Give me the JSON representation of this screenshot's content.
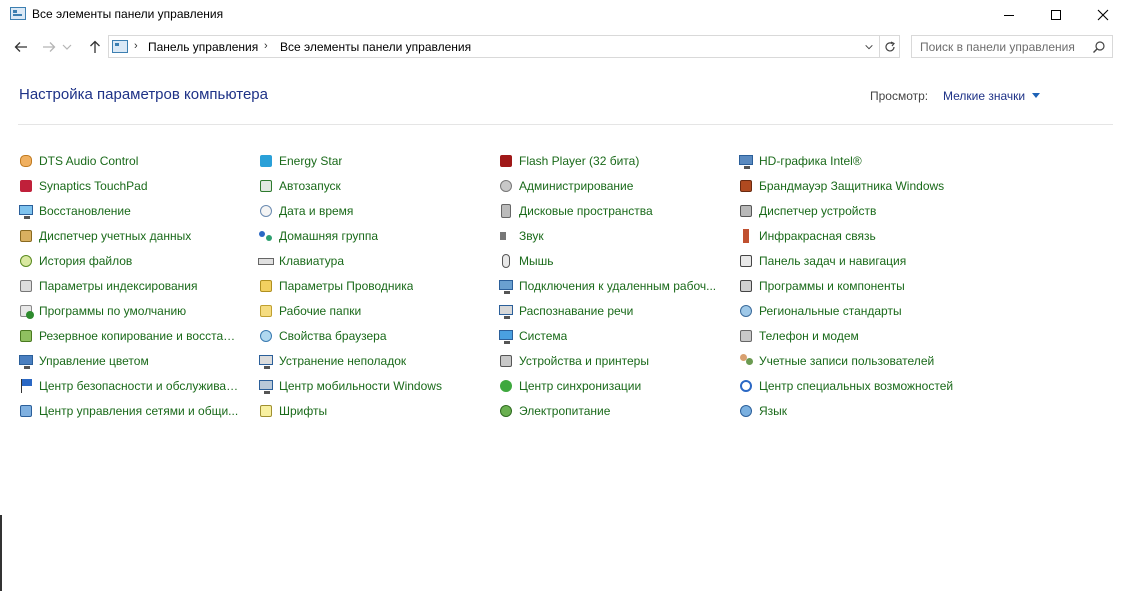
{
  "window": {
    "title": "Все элементы панели управления",
    "minimize_label": "",
    "maximize_label": "",
    "close_label": ""
  },
  "nav": {
    "breadcrumb": [
      "Панель управления",
      "Все элементы панели управления"
    ],
    "search_placeholder": "Поиск в панели управления"
  },
  "header": {
    "page_title": "Настройка параметров компьютера",
    "view_label": "Просмотр:",
    "view_value": "Мелкие значки"
  },
  "columns": [
    [
      {
        "label": "DTS Audio Control",
        "icon": "dts-audio-icon"
      },
      {
        "label": "Synaptics TouchPad",
        "icon": "touchpad-icon"
      },
      {
        "label": "Восстановление",
        "icon": "recovery-icon"
      },
      {
        "label": "Диспетчер учетных данных",
        "icon": "credential-manager-icon"
      },
      {
        "label": "История файлов",
        "icon": "file-history-icon"
      },
      {
        "label": "Параметры индексирования",
        "icon": "indexing-icon"
      },
      {
        "label": "Программы по умолчанию",
        "icon": "default-programs-icon"
      },
      {
        "label": "Резервное копирование и восстан...",
        "icon": "backup-icon"
      },
      {
        "label": "Управление цветом",
        "icon": "color-management-icon"
      },
      {
        "label": "Центр безопасности и обслуживан...",
        "icon": "security-flag-icon"
      },
      {
        "label": "Центр управления сетями и общи...",
        "icon": "network-center-icon"
      }
    ],
    [
      {
        "label": "Energy Star",
        "icon": "energy-star-icon"
      },
      {
        "label": "Автозапуск",
        "icon": "autoplay-icon"
      },
      {
        "label": "Дата и время",
        "icon": "date-time-icon"
      },
      {
        "label": "Домашняя группа",
        "icon": "homegroup-icon"
      },
      {
        "label": "Клавиатура",
        "icon": "keyboard-icon"
      },
      {
        "label": "Параметры Проводника",
        "icon": "explorer-options-icon"
      },
      {
        "label": "Рабочие папки",
        "icon": "work-folders-icon"
      },
      {
        "label": "Свойства браузера",
        "icon": "internet-options-icon"
      },
      {
        "label": "Устранение неполадок",
        "icon": "troubleshooting-icon"
      },
      {
        "label": "Центр мобильности Windows",
        "icon": "mobility-center-icon"
      },
      {
        "label": "Шрифты",
        "icon": "fonts-icon"
      }
    ],
    [
      {
        "label": "Flash Player (32 бита)",
        "icon": "flash-player-icon"
      },
      {
        "label": "Администрирование",
        "icon": "administration-icon"
      },
      {
        "label": "Дисковые пространства",
        "icon": "storage-spaces-icon"
      },
      {
        "label": "Звук",
        "icon": "sound-icon"
      },
      {
        "label": "Мышь",
        "icon": "mouse-icon"
      },
      {
        "label": "Подключения к удаленным рабоч...",
        "icon": "remote-desktop-icon"
      },
      {
        "label": "Распознавание речи",
        "icon": "speech-recognition-icon"
      },
      {
        "label": "Система",
        "icon": "system-icon"
      },
      {
        "label": "Устройства и принтеры",
        "icon": "devices-printers-icon"
      },
      {
        "label": "Центр синхронизации",
        "icon": "sync-center-icon"
      },
      {
        "label": "Электропитание",
        "icon": "power-options-icon"
      }
    ],
    [
      {
        "label": "HD-графика Intel®",
        "icon": "intel-graphics-icon"
      },
      {
        "label": "Брандмауэр Защитника Windows",
        "icon": "firewall-icon"
      },
      {
        "label": "Диспетчер устройств",
        "icon": "device-manager-icon"
      },
      {
        "label": "Инфракрасная связь",
        "icon": "infrared-icon"
      },
      {
        "label": "Панель задач и навигация",
        "icon": "taskbar-icon"
      },
      {
        "label": "Программы и компоненты",
        "icon": "programs-features-icon"
      },
      {
        "label": "Региональные стандарты",
        "icon": "region-icon"
      },
      {
        "label": "Телефон и модем",
        "icon": "phone-modem-icon"
      },
      {
        "label": "Учетные записи пользователей",
        "icon": "user-accounts-icon"
      },
      {
        "label": "Центр специальных возможностей",
        "icon": "ease-of-access-icon"
      },
      {
        "label": "Язык",
        "icon": "language-icon"
      }
    ]
  ],
  "colors": {
    "link_green": "#1a6a1a",
    "title_blue": "#1e3287"
  }
}
